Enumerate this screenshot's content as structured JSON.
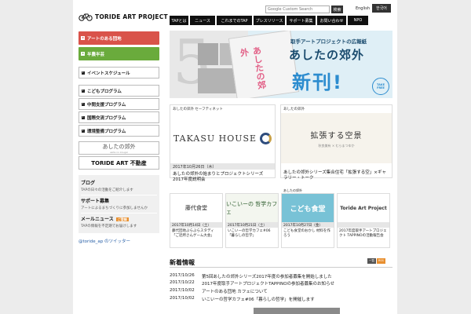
{
  "header": {
    "logo_text": "TORIDE ART PROJECT",
    "search_placeholder": "Google Custom Search",
    "search_button": "検索",
    "lang_en": "English",
    "lang_ko": "한국어",
    "nav": [
      "TAPとは",
      "ニュース",
      "これまでのTAP",
      "プレスリリース",
      "サポート募集",
      "お問い合わせ",
      "NPO"
    ]
  },
  "sidebar": {
    "primary": [
      {
        "label": "アートのある団地",
        "color": "#d9534a"
      },
      {
        "label": "半農半芸",
        "color": "#6aab3c"
      }
    ],
    "links_a": [
      "イベントスケジュール"
    ],
    "links_b": [
      "こどもプログラム",
      "中間支援プログラム",
      "国際交流プログラム",
      "環境整備プログラム"
    ],
    "banner1_title": "あしたの郊外",
    "banner1_sub": "asita no kougai",
    "banner2_title": "TORIDE ART 不動産",
    "info": [
      {
        "title": "ブログ",
        "sub": "TAPの日々の活動をご紹介します",
        "tag": ""
      },
      {
        "title": "サポート募集",
        "sub": "アートによるまちづくりに参加しませんか",
        "tag": ""
      },
      {
        "title": "メールニュース",
        "sub": "TAPの情報を不定期でお届けします",
        "tag": "ご登録"
      }
    ],
    "twitter": "@toride_ap のツイッター"
  },
  "hero": {
    "number": "5",
    "paper_title": "あしたの郊外",
    "subtitle": "取手アートプロジェクトの広報紙",
    "title": "あしたの郊外",
    "new_label": "新刊!",
    "free_label": "TAKE FREE"
  },
  "cards": [
    {
      "tag": "あしたの郊外 セーフティネット",
      "date": "2017年10月26日（木）",
      "title": "あしたの郊外の始まりとプロジェクトシリーズ2017年度説明会",
      "logo": "TAKASU HOUSE"
    },
    {
      "tag": "あしたの郊外",
      "date": "",
      "title": "あしたの郊外シリーズ集合住宅「拡張する空」×ギャラリー・トーク",
      "img_title": "拡張する空景",
      "img_sub": "秋良美有 × むらまつゆか"
    }
  ],
  "small_cards": [
    {
      "tag": "",
      "date": "2017年10月14日（土）",
      "title": "藤代団地ぶらぶらスタディ「ご近所さんゲーム大会」",
      "img": "藤代食堂"
    },
    {
      "tag": "",
      "date": "2017年10月21日（土）",
      "title": "いこいーの哲学カフェ#06「暮らしの哲学」",
      "img": "いこいーの 哲学カフェ"
    },
    {
      "tag": "あしたの郊外",
      "date": "2017年10月27日（金）",
      "title": "こども食堂のおかし 材料を作ろう",
      "img": "こども食堂"
    },
    {
      "tag": "",
      "date": "",
      "title": "2017年度取手アートプロジェクト TAPPINOの活動報告会",
      "img": "Toride Art Project"
    }
  ],
  "news": {
    "heading": "新着情報",
    "btn_list": "一覧",
    "btn_rss": "RSS",
    "items": [
      {
        "date": "2017/10/26",
        "text": "第5回あしたの郊外シリーズ2017年度の参加者募集を開始しました"
      },
      {
        "date": "2017/10/22",
        "text": "2017年度取手アートプロジェクトTAPPINOの参加者募集のお知らせ"
      },
      {
        "date": "2017/10/02",
        "text": "アートのある団地 カフェについて"
      },
      {
        "date": "2017/10/02",
        "text": "いこいーの哲学カフェ#06「暮らしの哲学」を開催します"
      }
    ]
  },
  "colors": {
    "red": "#d9534a",
    "green": "#6aab3c",
    "accent": "#2c8ccf",
    "orange": "#e88f2f"
  }
}
